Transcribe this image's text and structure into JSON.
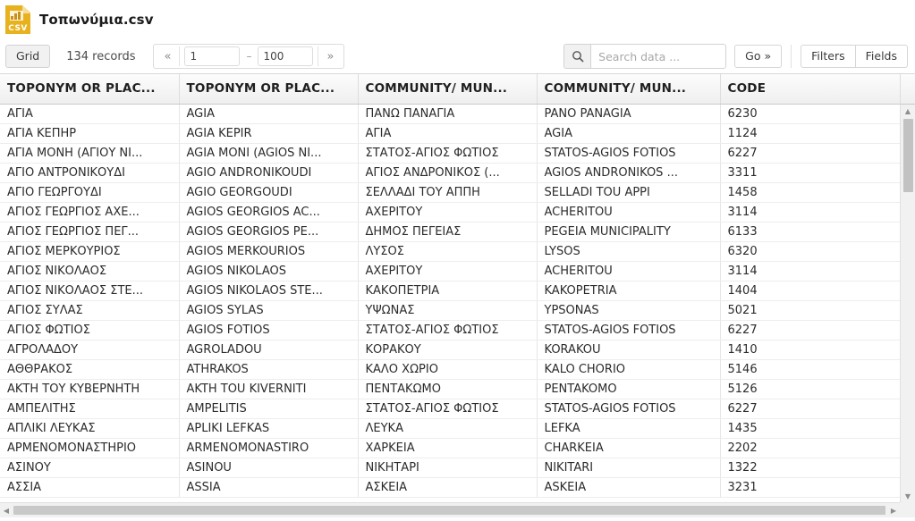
{
  "titlebar": {
    "file_icon_label": "CSV",
    "file_name": "Τοπωνύμια.csv"
  },
  "toolbar": {
    "grid_label": "Grid",
    "records_label": "134 records",
    "pager": {
      "first_label": "«",
      "last_label": "»",
      "from_value": "1",
      "dash": "–",
      "to_value": "100"
    },
    "search": {
      "placeholder": "Search data ...",
      "value": "",
      "go_label": "Go »"
    },
    "filters_label": "Filters",
    "fields_label": "Fields"
  },
  "grid": {
    "columns": [
      "TOPONYM OR PLAC...",
      "TOPONYM OR PLAC...",
      "COMMUNITY/ MUN...",
      "COMMUNITY/ MUN...",
      "CODE"
    ],
    "rows": [
      [
        "ΑΓΙΑ",
        "AGIA",
        "ΠΑΝΩ ΠΑΝΑΓΙΑ",
        "PANO PANAGIA",
        "6230"
      ],
      [
        "ΑΓΙΑ ΚΕΠΗΡ",
        "AGIA KEPIR",
        "ΑΓΙΑ",
        "AGIA",
        "1124"
      ],
      [
        "ΑΓΙΑ ΜΟΝΗ (ΑΓΙΟΥ ΝΙ...",
        "AGIA MONI (AGIOS NI...",
        "ΣΤΑΤΟΣ-ΑΓΙΟΣ ΦΩΤΙΟΣ",
        "STATOS-AGIOS FOTIOS",
        "6227"
      ],
      [
        "ΑΓΙΟ ΑΝΤΡΟΝΙΚΟΥΔΙ",
        "AGIO ANDRONIKOUDI",
        "ΑΓΙΟΣ ΑΝΔΡΟΝΙΚΟΣ (...",
        "AGIOS ANDRONIKOS ...",
        "3311"
      ],
      [
        "ΑΓΙΟ ΓΕΩΡΓΟΥΔΙ",
        "AGIO GEORGOUDI",
        "ΣΕΛΛΑΔΙ ΤΟΥ ΑΠΠΗ",
        "SELLADI TOU APPI",
        "1458"
      ],
      [
        "ΑΓΙΟΣ ΓΕΩΡΓΙΟΣ ΑΧΕ...",
        "AGIOS GEORGIOS AC...",
        "ΑΧΕΡΙΤΟΥ",
        "ACHERITOU",
        "3114"
      ],
      [
        "ΑΓΙΟΣ ΓΕΩΡΓΙΟΣ ΠΕΓ...",
        "AGIOS GEORGIOS PE...",
        "ΔΗΜΟΣ ΠΕΓΕΙΑΣ",
        "PEGEIA MUNICIPALITY",
        "6133"
      ],
      [
        "ΑΓΙΟΣ ΜΕΡΚΟΥΡΙΟΣ",
        "AGIOS MERKOURIOS",
        "ΛΥΣΟΣ",
        "LYSOS",
        "6320"
      ],
      [
        "ΑΓΙΟΣ ΝΙΚΟΛΑΟΣ",
        "AGIOS NIKOLAOS",
        "ΑΧΕΡΙΤΟΥ",
        "ACHERITOU",
        "3114"
      ],
      [
        "ΑΓΙΟΣ ΝΙΚΟΛΑΟΣ ΣΤΕ...",
        "AGIOS NIKOLAOS STE...",
        "ΚΑΚΟΠΕΤΡΙΑ",
        "KAKOPETRIA",
        "1404"
      ],
      [
        "ΑΓΙΟΣ ΣΥΛΑΣ",
        "AGIOS SYLAS",
        "ΥΨΩΝΑΣ",
        "YPSONAS",
        "5021"
      ],
      [
        "ΑΓΙΟΣ ΦΩΤΙΟΣ",
        "AGIOS FOTIOS",
        "ΣΤΑΤΟΣ-ΑΓΙΟΣ ΦΩΤΙΟΣ",
        "STATOS-AGIOS FOTIOS",
        "6227"
      ],
      [
        "ΑΓΡΟΛΑΔΟΥ",
        "AGROLADOU",
        "ΚΟΡΑΚΟΥ",
        "KORAKOU",
        "1410"
      ],
      [
        "ΑΘΘΡΑΚΟΣ",
        "ATHRAKOS",
        "ΚΑΛΟ ΧΩΡΙΟ",
        "KALO CHORIO",
        "5146"
      ],
      [
        "ΑΚΤΗ ΤΟΥ ΚΥΒΕΡΝΗΤΗ",
        "AKTH TOU KIVERNITI",
        "ΠΕΝΤΑΚΩΜΟ",
        "PENTAKOMO",
        "5126"
      ],
      [
        "ΑΜΠΕΛΙΤΗΣ",
        "AMPELITIS",
        "ΣΤΑΤΟΣ-ΑΓΙΟΣ ΦΩΤΙΟΣ",
        "STATOS-AGIOS FOTIOS",
        "6227"
      ],
      [
        "ΑΠΛΙΚΙ ΛΕΥΚΑΣ",
        "APLIKI LEFKAS",
        "ΛΕΥΚΑ",
        "LEFKA",
        "1435"
      ],
      [
        "ΑΡΜΕΝΟΜΟΝΑΣΤΗΡΙΟ",
        "ARMENOMONASTIRO",
        "ΧΑΡΚΕΙΑ",
        "CHARKEIA",
        "2202"
      ],
      [
        "ΑΣΙΝΟΥ",
        "ASINOU",
        "ΝΙΚΗΤΑΡΙ",
        "NIKITARI",
        "1322"
      ],
      [
        "ΑΣΣΙΑ",
        "ASSIA",
        "ΑΣΚΕΙΑ",
        "ASKEIA",
        "3231"
      ]
    ]
  },
  "scrollbars": {
    "up_arrow": "▲",
    "down_arrow": "▼",
    "left_arrow": "◀",
    "right_arrow": "▶"
  }
}
